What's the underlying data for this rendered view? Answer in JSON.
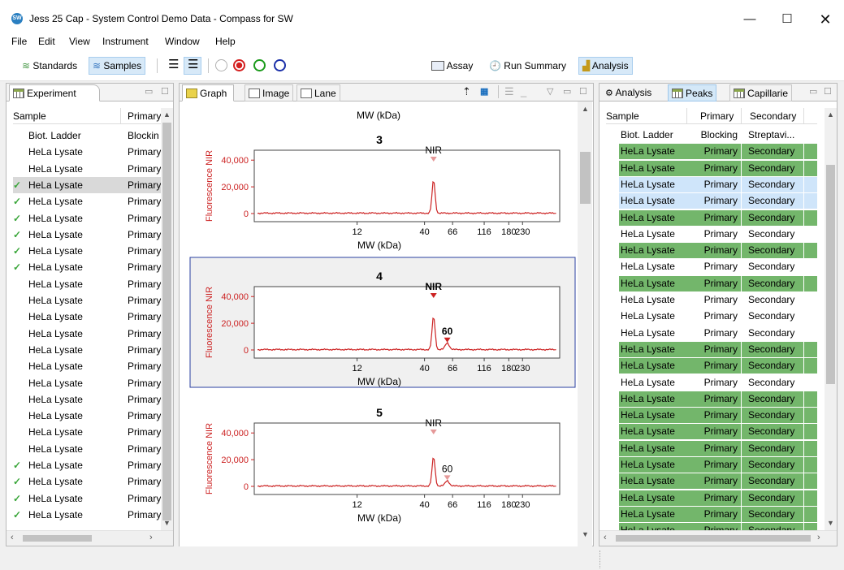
{
  "window": {
    "title": "Jess 25 Cap - System Control Demo Data  - Compass for SW",
    "app_icon": "SW"
  },
  "menu": [
    "File",
    "Edit",
    "View",
    "Instrument",
    "Window",
    "Help"
  ],
  "toolbar": {
    "standards": "Standards",
    "samples": "Samples",
    "assay": "Assay",
    "run_summary": "Run Summary",
    "analysis": "Analysis"
  },
  "experiment": {
    "tab": "Experiment",
    "col_sample": "Sample",
    "col_primary": "Primary",
    "rows": [
      {
        "sample": "Biot. Ladder",
        "primary": "Blockin",
        "check": false
      },
      {
        "sample": "HeLa Lysate",
        "primary": "Primary",
        "check": false
      },
      {
        "sample": "HeLa Lysate",
        "primary": "Primary",
        "check": false
      },
      {
        "sample": "HeLa Lysate",
        "primary": "Primary",
        "check": true
      },
      {
        "sample": "HeLa Lysate",
        "primary": "Primary",
        "check": true
      },
      {
        "sample": "HeLa Lysate",
        "primary": "Primary",
        "check": true
      },
      {
        "sample": "HeLa Lysate",
        "primary": "Primary",
        "check": true
      },
      {
        "sample": "HeLa Lysate",
        "primary": "Primary",
        "check": true
      },
      {
        "sample": "HeLa Lysate",
        "primary": "Primary",
        "check": true
      },
      {
        "sample": "HeLa Lysate",
        "primary": "Primary",
        "check": false
      },
      {
        "sample": "HeLa Lysate",
        "primary": "Primary",
        "check": false
      },
      {
        "sample": "HeLa Lysate",
        "primary": "Primary",
        "check": false
      },
      {
        "sample": "HeLa Lysate",
        "primary": "Primary",
        "check": false
      },
      {
        "sample": "HeLa Lysate",
        "primary": "Primary",
        "check": false
      },
      {
        "sample": "HeLa Lysate",
        "primary": "Primary",
        "check": false
      },
      {
        "sample": "HeLa Lysate",
        "primary": "Primary",
        "check": false
      },
      {
        "sample": "HeLa Lysate",
        "primary": "Primary",
        "check": false
      },
      {
        "sample": "HeLa Lysate",
        "primary": "Primary",
        "check": false
      },
      {
        "sample": "HeLa Lysate",
        "primary": "Primary",
        "check": false
      },
      {
        "sample": "HeLa Lysate",
        "primary": "Primary",
        "check": false
      },
      {
        "sample": "HeLa Lysate",
        "primary": "Primary",
        "check": true
      },
      {
        "sample": "HeLa Lysate",
        "primary": "Primary",
        "check": true
      },
      {
        "sample": "HeLa Lysate",
        "primary": "Primary",
        "check": true
      },
      {
        "sample": "HeLa Lysate",
        "primary": "Primary",
        "check": true
      }
    ]
  },
  "graph_panel": {
    "tabs": [
      "Graph",
      "Image",
      "Lane"
    ],
    "top_axis_label": "MW (kDa)",
    "ylabel": "Fluorescence NIR",
    "xlabel": "MW (kDa)",
    "x_ticks": [
      "12",
      "40",
      "66",
      "116",
      "180",
      "230"
    ],
    "y_ticks": [
      "40,000",
      "20,000",
      "0"
    ]
  },
  "chart_data": [
    {
      "type": "line",
      "title": "3",
      "xlabel": "MW (kDa)",
      "ylabel": "Fluorescence NIR",
      "peaks": [
        {
          "label": "NIR",
          "mw": 47,
          "value": 25000
        }
      ],
      "ylim": [
        0,
        45000
      ],
      "selected": false,
      "bold_labels": false
    },
    {
      "type": "line",
      "title": "4",
      "xlabel": "MW (kDa)",
      "ylabel": "Fluorescence NIR",
      "peaks": [
        {
          "label": "NIR",
          "mw": 47,
          "value": 25000
        },
        {
          "label": "60",
          "mw": 60,
          "value": 5000
        }
      ],
      "ylim": [
        0,
        45000
      ],
      "selected": true,
      "bold_labels": true
    },
    {
      "type": "line",
      "title": "5",
      "xlabel": "MW (kDa)",
      "ylabel": "Fluorescence NIR",
      "peaks": [
        {
          "label": "NIR",
          "mw": 47,
          "value": 22000
        },
        {
          "label": "60",
          "mw": 60,
          "value": 4000
        }
      ],
      "ylim": [
        0,
        45000
      ],
      "selected": false,
      "bold_labels": false
    }
  ],
  "right_panel": {
    "tabs": [
      "Analysis",
      "Peaks",
      "Capillarie"
    ],
    "col_sample": "Sample",
    "col_primary": "Primary",
    "col_secondary": "Secondary",
    "rows": [
      {
        "sample": "Biot. Ladder",
        "primary": "Blocking",
        "secondary": "Streptavi...",
        "state": "none"
      },
      {
        "sample": "HeLa Lysate",
        "primary": "Primary",
        "secondary": "Secondary",
        "state": "green"
      },
      {
        "sample": "HeLa Lysate",
        "primary": "Primary",
        "secondary": "Secondary",
        "state": "green"
      },
      {
        "sample": "HeLa Lysate",
        "primary": "Primary",
        "secondary": "Secondary",
        "state": "blue"
      },
      {
        "sample": "HeLa Lysate",
        "primary": "Primary",
        "secondary": "Secondary",
        "state": "blue"
      },
      {
        "sample": "HeLa Lysate",
        "primary": "Primary",
        "secondary": "Secondary",
        "state": "green"
      },
      {
        "sample": "HeLa Lysate",
        "primary": "Primary",
        "secondary": "Secondary",
        "state": "none"
      },
      {
        "sample": "HeLa Lysate",
        "primary": "Primary",
        "secondary": "Secondary",
        "state": "green"
      },
      {
        "sample": "HeLa Lysate",
        "primary": "Primary",
        "secondary": "Secondary",
        "state": "none"
      },
      {
        "sample": "HeLa Lysate",
        "primary": "Primary",
        "secondary": "Secondary",
        "state": "green"
      },
      {
        "sample": "HeLa Lysate",
        "primary": "Primary",
        "secondary": "Secondary",
        "state": "none"
      },
      {
        "sample": "HeLa Lysate",
        "primary": "Primary",
        "secondary": "Secondary",
        "state": "none"
      },
      {
        "sample": "HeLa Lysate",
        "primary": "Primary",
        "secondary": "Secondary",
        "state": "none"
      },
      {
        "sample": "HeLa Lysate",
        "primary": "Primary",
        "secondary": "Secondary",
        "state": "green"
      },
      {
        "sample": "HeLa Lysate",
        "primary": "Primary",
        "secondary": "Secondary",
        "state": "green"
      },
      {
        "sample": "HeLa Lysate",
        "primary": "Primary",
        "secondary": "Secondary",
        "state": "none"
      },
      {
        "sample": "HeLa Lysate",
        "primary": "Primary",
        "secondary": "Secondary",
        "state": "green"
      },
      {
        "sample": "HeLa Lysate",
        "primary": "Primary",
        "secondary": "Secondary",
        "state": "green"
      },
      {
        "sample": "HeLa Lysate",
        "primary": "Primary",
        "secondary": "Secondary",
        "state": "green"
      },
      {
        "sample": "HeLa Lysate",
        "primary": "Primary",
        "secondary": "Secondary",
        "state": "green"
      },
      {
        "sample": "HeLa Lysate",
        "primary": "Primary",
        "secondary": "Secondary",
        "state": "green"
      },
      {
        "sample": "HeLa Lysate",
        "primary": "Primary",
        "secondary": "Secondary",
        "state": "green"
      },
      {
        "sample": "HeLa Lysate",
        "primary": "Primary",
        "secondary": "Secondary",
        "state": "green"
      },
      {
        "sample": "HeLa Lysate",
        "primary": "Primary",
        "secondary": "Secondary",
        "state": "green"
      },
      {
        "sample": "HeLa Lysate",
        "primary": "Primary",
        "secondary": "Secondary",
        "state": "green"
      }
    ]
  },
  "colors": {
    "trace": "#cc2222",
    "peak_green": "#73b66b",
    "row_blue": "#cfe5fa",
    "selected_border": "#2a3fa0",
    "check": "#3aa63a"
  }
}
